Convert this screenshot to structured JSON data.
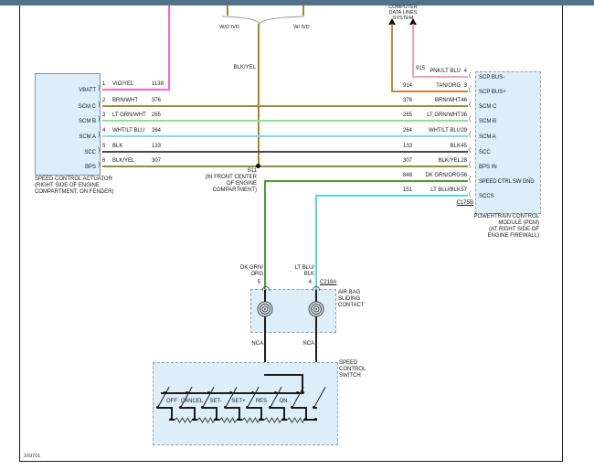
{
  "colors": {
    "vio_yel": "#ff63c5",
    "brn_wht": "#a8894b",
    "lt_grn_wht": "#8fe08f",
    "wht_lt_blu": "#79dfe8",
    "blk": "#46494d",
    "blk_yel": "#998a35",
    "tan_org": "#c9863a",
    "pnk_lt_blu": "#f29ec0",
    "dk_grn_org": "#4f9b33",
    "lt_blu_blk": "#57d7e2",
    "black_wire": "#1c1c1c",
    "box_fill": "#ddeef9",
    "top_bar": "#54718c"
  },
  "header": {
    "computer_data_lines": [
      "COMPUTER",
      "DATA LINES",
      "SYSTEM"
    ],
    "branch_left": "W/O IVD",
    "branch_right": "W/ IVD",
    "blk_yel_label": "BLK/YEL"
  },
  "actuator": {
    "title": [
      "SPEED CONTROL ACTUATOR",
      "(RIGHT SIDE OF ENGINE",
      "COMPARTMENT, ON FENDER)"
    ],
    "pins": [
      {
        "pin": "1",
        "name": "VBATT",
        "color": "VIO/YEL",
        "circuit": "1139"
      },
      {
        "pin": "2",
        "name": "SCM C",
        "color": "BRN/WHT",
        "circuit": "376"
      },
      {
        "pin": "3",
        "name": "SCM B",
        "color": "LT GRN/WHT",
        "circuit": "265"
      },
      {
        "pin": "4",
        "name": "SCM A",
        "color": "WHT/LT BLU",
        "circuit": "264"
      },
      {
        "pin": "5",
        "name": "SCC",
        "color": "BLK",
        "circuit": "133"
      },
      {
        "pin": "6",
        "name": "BPS",
        "color": "BLK/YEL",
        "circuit": "307"
      }
    ]
  },
  "pcm": {
    "title": [
      "POWERTRAIN CONTROL",
      "MODULE (PCM)",
      "(AT RIGHT SIDE OF",
      "ENGINE FIREWALL)"
    ],
    "connector": "C175B",
    "pins": [
      {
        "circuit": "915",
        "color": "PNK/LT BLU",
        "pin": "4",
        "name": "SCP BUS-"
      },
      {
        "circuit": "914",
        "color": "TAN/ORG",
        "pin": "3",
        "name": "SCP BUS+"
      },
      {
        "circuit": "376",
        "color": "BRN/WHT",
        "pin": "46",
        "name": "SCM C"
      },
      {
        "circuit": "265",
        "color": "LT GRN/WHT",
        "pin": "36",
        "name": "SCM B"
      },
      {
        "circuit": "264",
        "color": "WHT/LT BLU",
        "pin": "29",
        "name": "SCM A"
      },
      {
        "circuit": "133",
        "color": "BLK",
        "pin": "45",
        "name": "SCC"
      },
      {
        "circuit": "307",
        "color": "BLK/YEL",
        "pin": "28",
        "name": "BPS IN"
      },
      {
        "circuit": "848",
        "color": "DK GRN/ORG",
        "pin": "56",
        "name": "SPEED CTRL SW GND"
      },
      {
        "circuit": "151",
        "color": "LT BLU/BLK",
        "pin": "57",
        "name": "SCCS"
      }
    ]
  },
  "splice": {
    "id": "S11",
    "location": [
      "(IN FRONT CENTER",
      "OF ENGINE",
      "COMPARTMENT)"
    ]
  },
  "airbag": {
    "title": [
      "AIR BAG",
      "SLIDING",
      "CONTACT"
    ],
    "connector": "C218A",
    "pin_left": "5",
    "pin_right": "4",
    "wire_left": [
      "DK GRN/",
      "ORG"
    ],
    "wire_right": [
      "LT BLU/",
      "BLK"
    ],
    "nca": "NCA"
  },
  "sw_box": {
    "title": [
      "SPEED",
      "CONTROL",
      "SWITCH"
    ],
    "labels": [
      "OFF",
      "CANCEL",
      "SET-",
      "SET+",
      "RES",
      "ON"
    ]
  },
  "footer": {
    "doc": "169701"
  }
}
